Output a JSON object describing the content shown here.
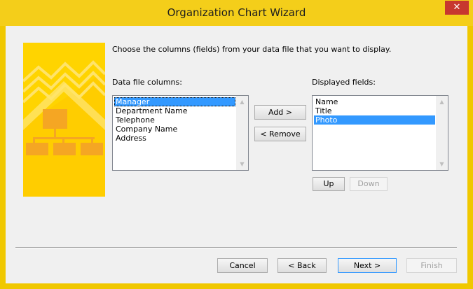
{
  "window": {
    "title": "Organization Chart Wizard",
    "close_glyph": "✕"
  },
  "instruction": "Choose the columns (fields) from your data file that you want to display.",
  "data_file": {
    "label": "Data file columns:",
    "items": [
      "Manager",
      "Department Name",
      "Telephone",
      "Company Name",
      "Address"
    ],
    "selected": "Manager"
  },
  "displayed": {
    "label": "Displayed fields:",
    "items": [
      "Name",
      "Title",
      "Photo"
    ],
    "selected": "Photo"
  },
  "buttons": {
    "add": "Add >",
    "remove": "< Remove",
    "up": "Up",
    "down": "Down",
    "cancel": "Cancel",
    "back": "< Back",
    "next": "Next >",
    "finish": "Finish"
  },
  "colors": {
    "accent": "#ffd200",
    "selection": "#3399ff",
    "close": "#c7372f"
  }
}
